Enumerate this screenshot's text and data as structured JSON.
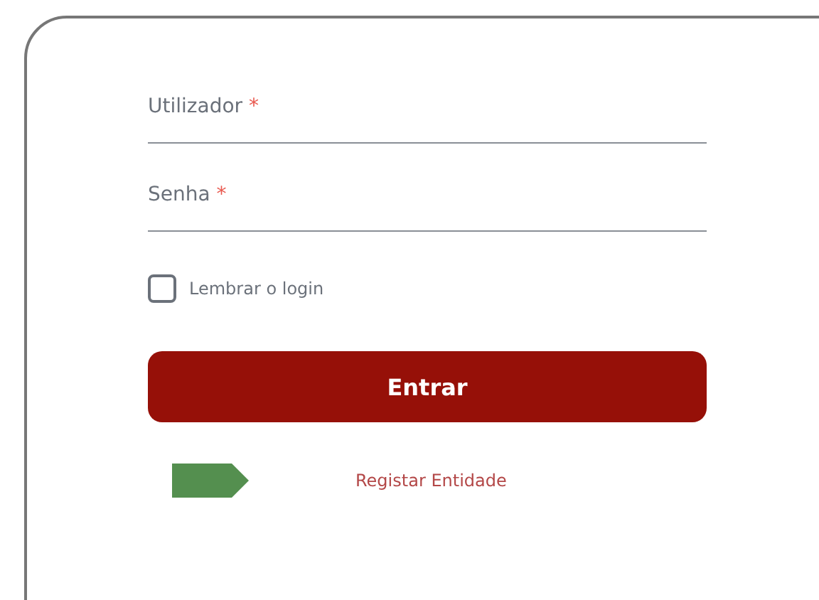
{
  "fields": [
    {
      "label": "Utilizador",
      "required_mark": "*"
    },
    {
      "label": "Senha",
      "required_mark": "*"
    }
  ],
  "remember": {
    "label": "Lembrar o login",
    "checked": false
  },
  "submit": {
    "label": "Entrar"
  },
  "register_link": {
    "label": "Registar Entidade"
  }
}
